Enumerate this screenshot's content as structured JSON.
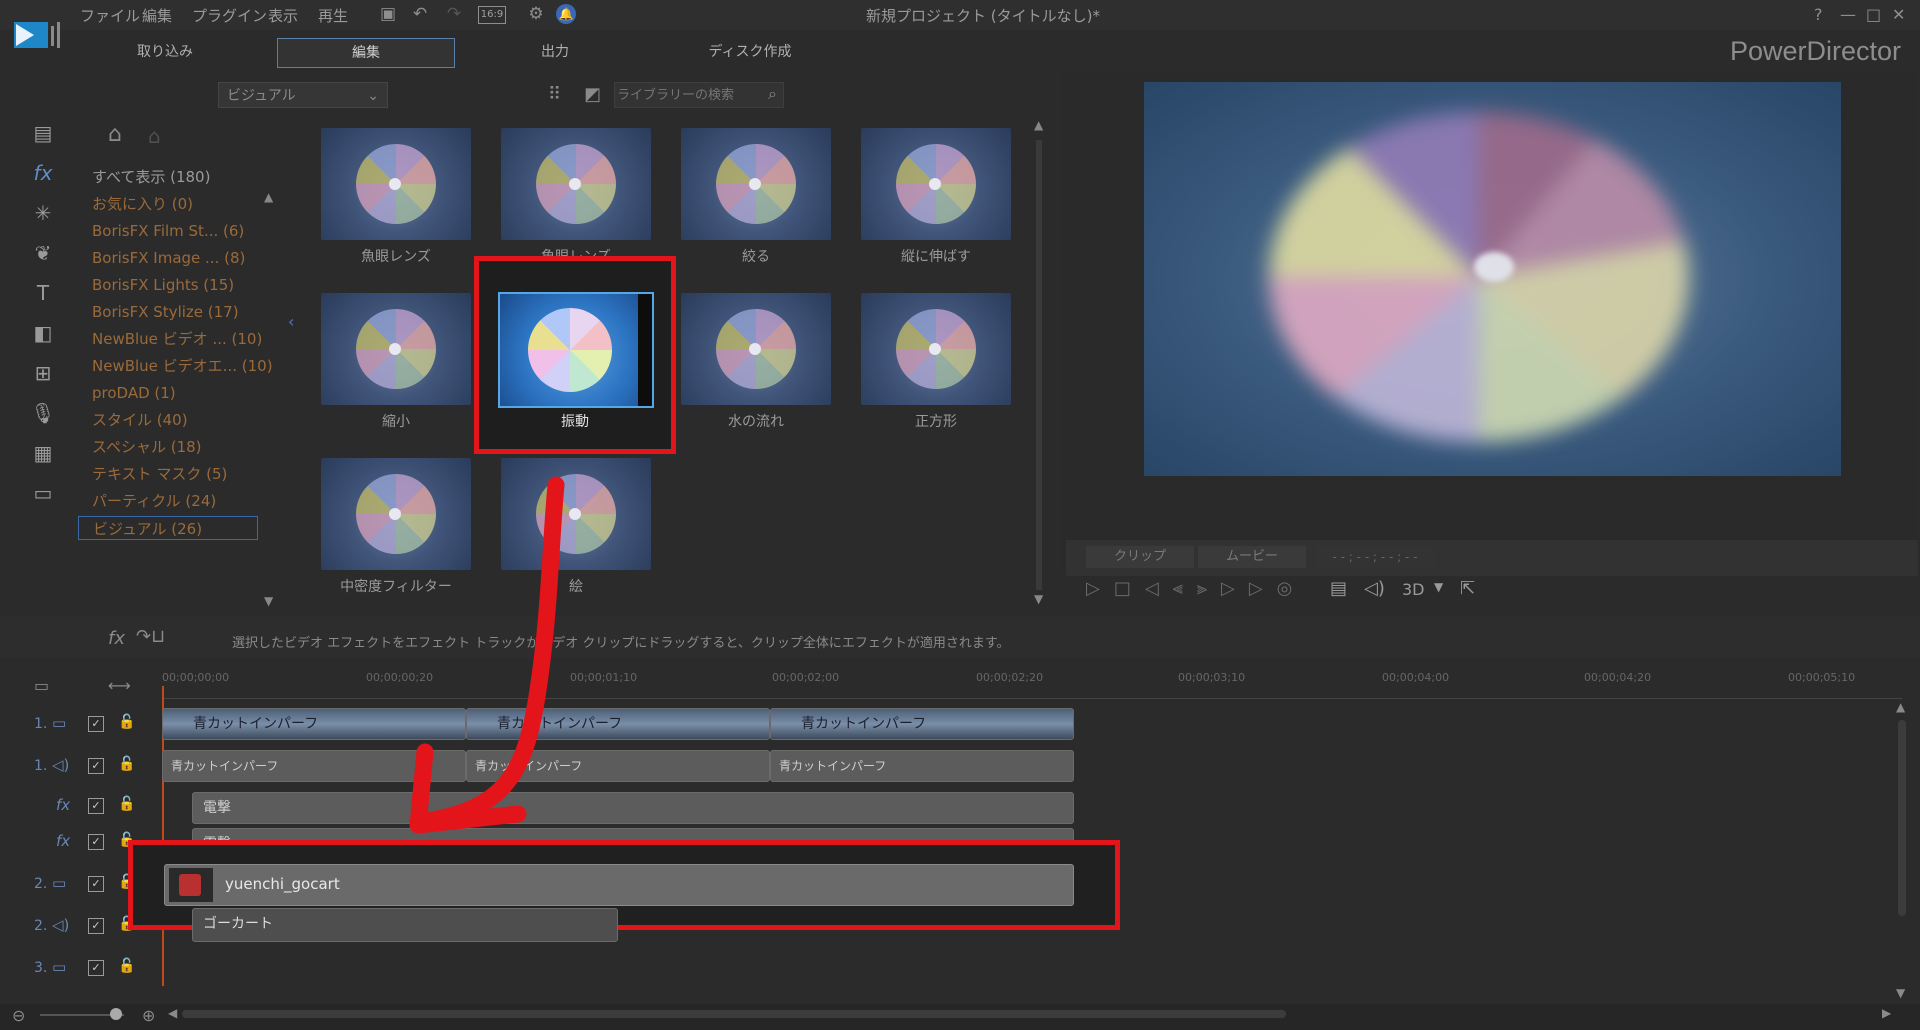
{
  "window": {
    "title": "新規プロジェクト (タイトルなし)*",
    "brand": "PowerDirector"
  },
  "menu": [
    "ファイル",
    "編集",
    "プラグイン",
    "表示",
    "再生"
  ],
  "toolbar_icons": [
    "save-icon",
    "undo-icon",
    "redo-icon",
    "aspect-ratio-icon",
    "settings-icon",
    "notification-icon"
  ],
  "aspect": "16:9",
  "window_controls": [
    "?",
    "—",
    "□",
    "✕"
  ],
  "mode_tabs": [
    "取り込み",
    "編集",
    "出力",
    "ディスク作成"
  ],
  "library": {
    "filter": "ビジュアル",
    "search_placeholder": "ライブラリーの検索"
  },
  "categories": [
    "すべて表示 (180)",
    "お気に入り (0)",
    "BorisFX Film St... (6)",
    "BorisFX Image ... (8)",
    "BorisFX Lights (15)",
    "BorisFX Stylize (17)",
    "NewBlue ビデオ ... (10)",
    "NewBlue ビデオエ... (10)",
    "proDAD (1)",
    "スタイル (40)",
    "スペシャル (18)",
    "テキスト マスク (5)",
    "パーティクル (24)",
    "ビジュアル (26)"
  ],
  "effects": [
    "魚眼レンズ",
    "魚眼レンズ",
    "絞る",
    "縦に伸ばす",
    "縮小",
    "振動",
    "水の流れ",
    "正方形",
    "中密度フィルター",
    "絵"
  ],
  "preview": {
    "tab_clip": "クリップ",
    "tab_movie": "ムービー",
    "timecode": "- - ; - - ; - - ; - -",
    "mode_3d": "3D"
  },
  "hint": "選択したビデオ エフェクトをエフェクト トラックかビデオ クリップにドラッグすると、クリップ全体にエフェクトが適用されます。",
  "ruler": [
    "00;00;00;00",
    "00;00;00;20",
    "00;00;01;10",
    "00;00;02;00",
    "00;00;02;20",
    "00;00;03;10",
    "00;00;04;00",
    "00;00;04;20",
    "00;00;05;10"
  ],
  "tracks": {
    "labels": [
      "1.",
      "1.",
      "2.",
      "2.",
      "3."
    ],
    "video_clip": "青カットインパーフ",
    "audio_clip": "青カットインパーフ",
    "fx1": "電撃",
    "fx2": "電撃",
    "clip2": "yuenchi_gocart",
    "audio2": "ゴーカート"
  }
}
